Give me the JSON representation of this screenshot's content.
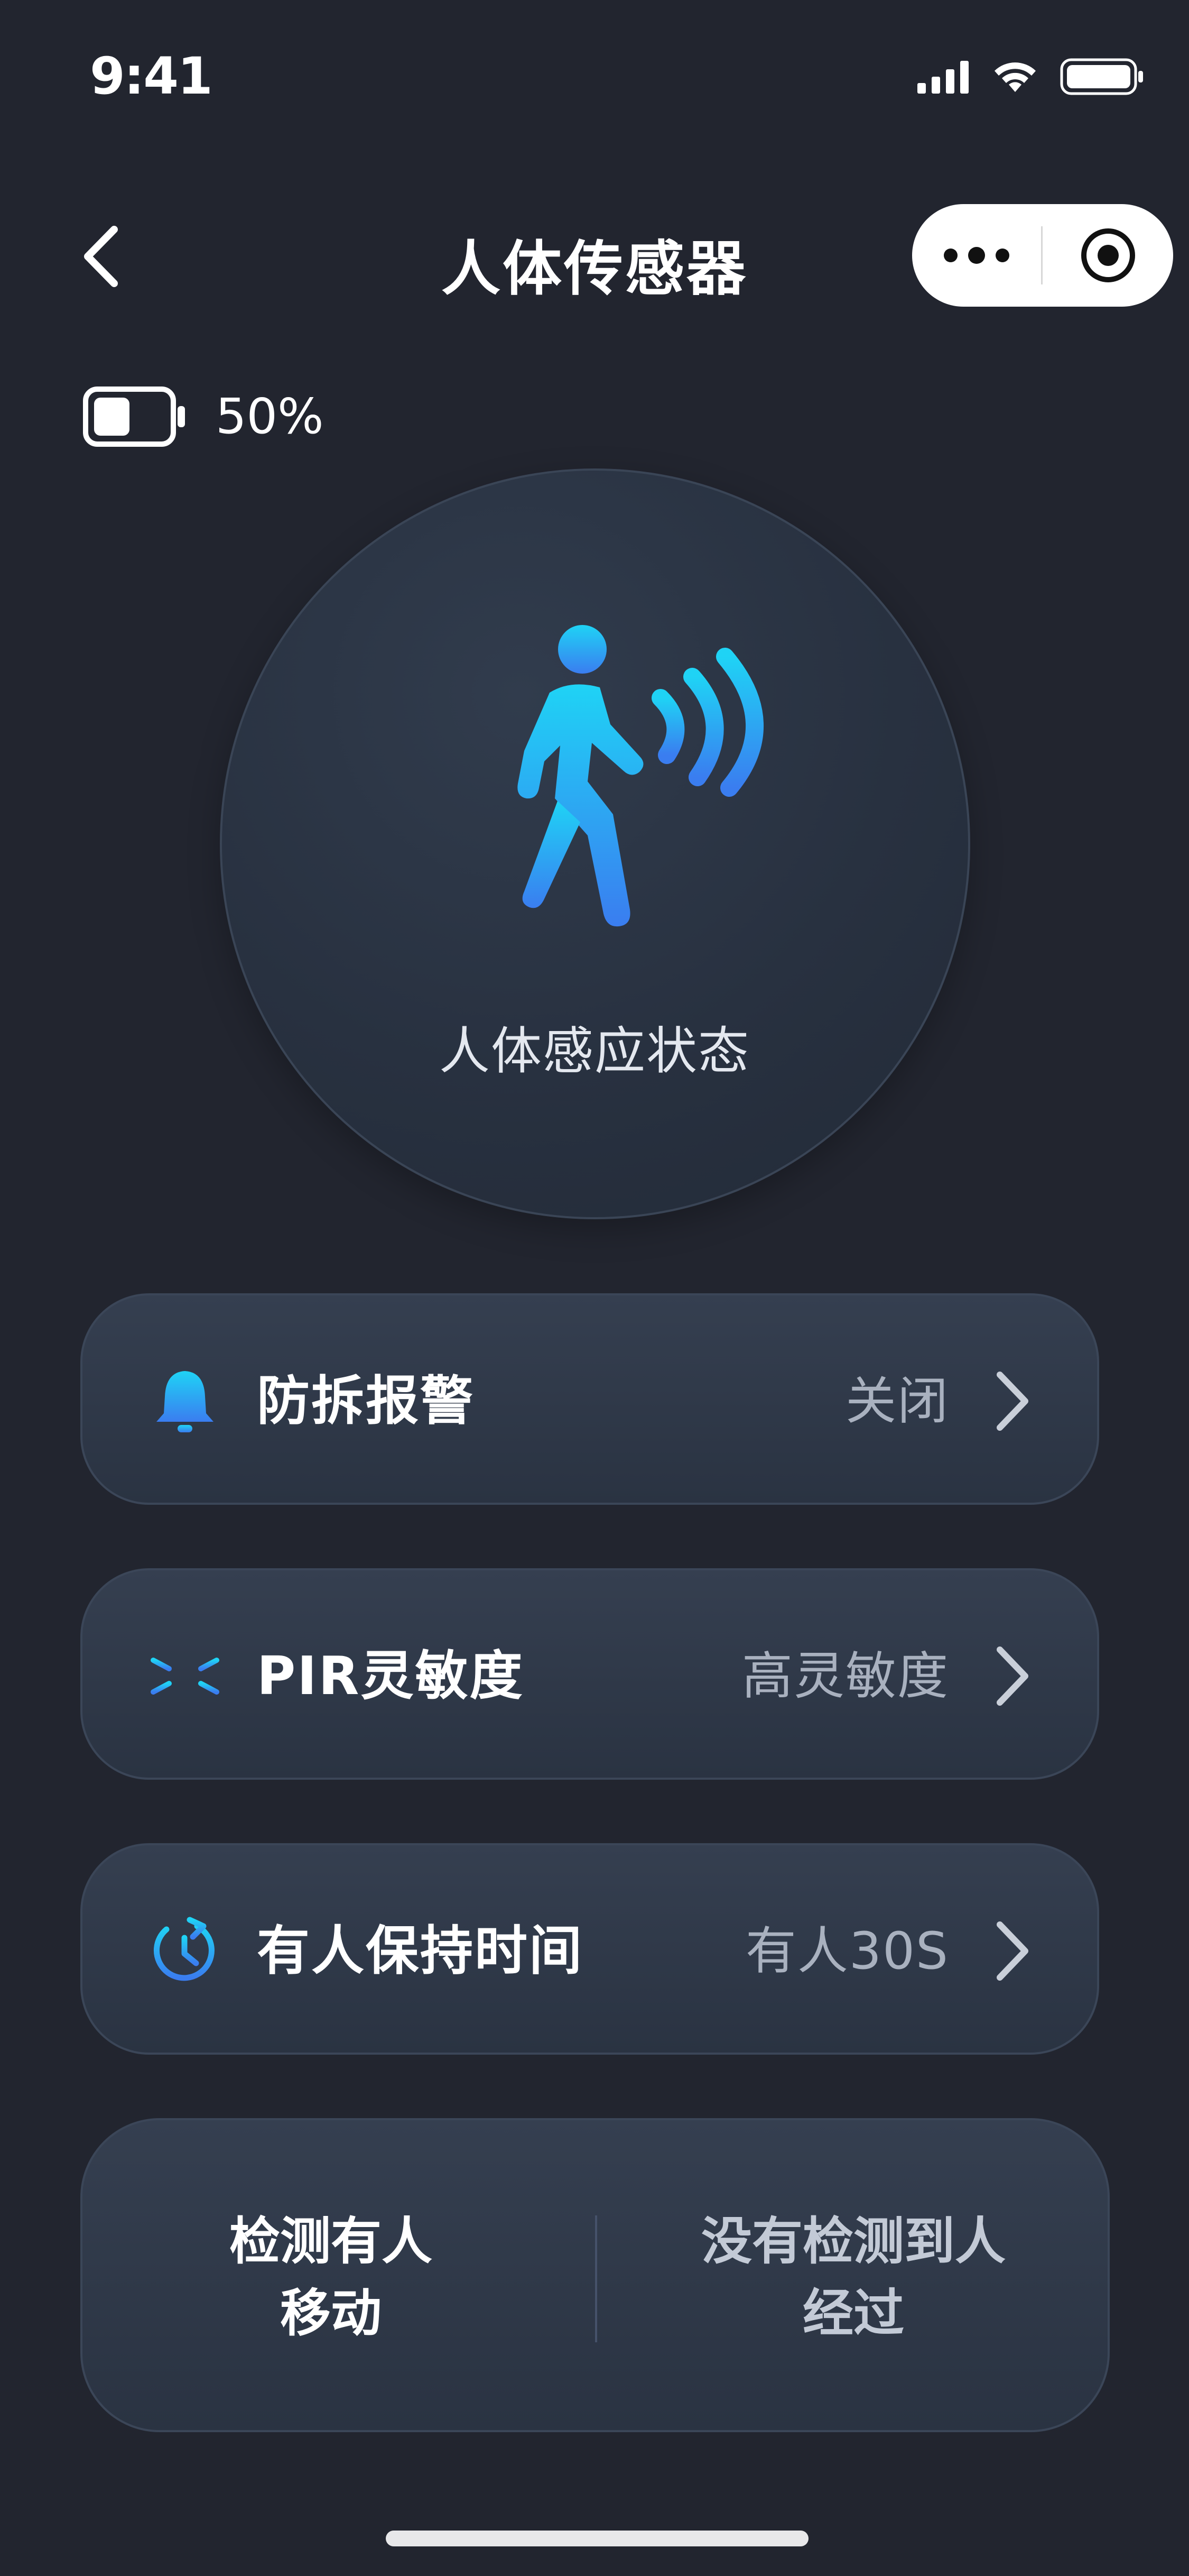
{
  "status_bar": {
    "time": "9:41"
  },
  "nav": {
    "title": "人体传感器"
  },
  "battery": {
    "percent_label": "50%",
    "level": 0.5
  },
  "sensor": {
    "status_label": "人体感应状态"
  },
  "settings": [
    {
      "label": "防拆报警",
      "value": "关闭",
      "icon": "bell-icon"
    },
    {
      "label": "PIR灵敏度",
      "value": "高灵敏度",
      "icon": "sensitivity-icon"
    },
    {
      "label": "有人保持时间",
      "value": "有人30S",
      "icon": "timer-icon"
    }
  ],
  "detection": {
    "left_line1": "检测有人",
    "left_line2": "移动",
    "right_line1": "没有检测到人",
    "right_line2": "经过"
  },
  "colors": {
    "background": "#22252f",
    "accent_start": "#1fd3f5",
    "accent_end": "#3a7df0"
  }
}
